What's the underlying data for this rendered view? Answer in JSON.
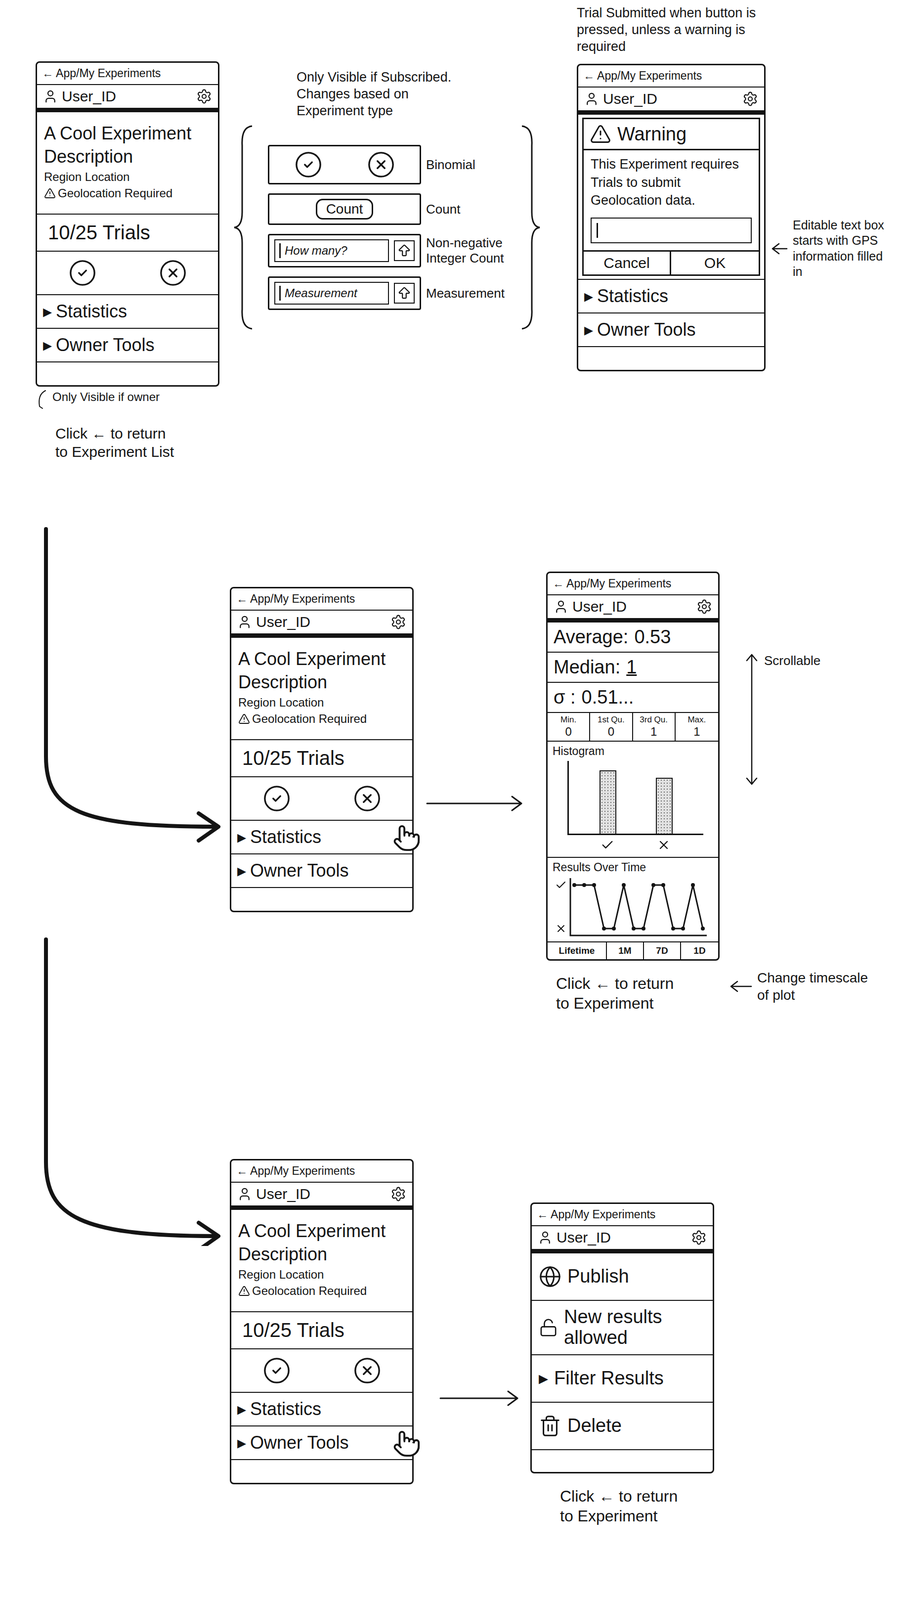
{
  "app_bar": {
    "back": "← App/My Experiments",
    "user": "User_ID"
  },
  "experiment": {
    "title": "A Cool Experiment",
    "description": "Description",
    "region": "Region Location",
    "geolocation": "Geolocation Required",
    "trials": "10/25 Trials",
    "sections": [
      {
        "marker": "▸",
        "label": "Statistics"
      },
      {
        "marker": "▸",
        "label": "Owner Tools"
      }
    ]
  },
  "experiment_screens": [
    {
      "pressed": [
        false,
        false
      ]
    },
    {
      "pressed": [
        true,
        false
      ]
    },
    {
      "pressed": [
        false,
        true
      ]
    }
  ],
  "experiment_notes": {
    "owner_only": "Only Visible if owner",
    "return": "Click ← to return to Experiment List"
  },
  "input_types": {
    "note": "Only Visible if Subscribed. Changes based on Experiment type",
    "items": [
      {
        "kind": "binomial",
        "label": "Binomial"
      },
      {
        "kind": "count",
        "label": "Count",
        "button": "Count"
      },
      {
        "kind": "integer",
        "label": "Non-negative Integer Count",
        "placeholder": "How many?"
      },
      {
        "kind": "measurement",
        "label": "Measurement",
        "placeholder": "Measurement"
      }
    ]
  },
  "warning": {
    "note": "Trial Submitted when button is pressed, unless a warning is required",
    "title": "Warning",
    "message": "This Experiment requires Trials to submit Geolocation data.",
    "field_note": "Editable text box starts with GPS information filled in",
    "buttons": [
      "Cancel",
      "OK"
    ]
  },
  "statistics": {
    "scroll_note": "Scrollable",
    "summary": [
      {
        "label": "Average:",
        "value": "0.53",
        "underlined": false
      },
      {
        "label": "Median:",
        "value": "1",
        "underlined": true
      },
      {
        "label": "σ :",
        "value": "0.51...",
        "underlined": false
      }
    ],
    "quartiles": [
      {
        "label": "Min.",
        "value": "0"
      },
      {
        "label": "1st Qu.",
        "value": "0"
      },
      {
        "label": "3rd Qu.",
        "value": "1"
      },
      {
        "label": "Max.",
        "value": "1"
      }
    ],
    "histogram": {
      "title": "Histogram",
      "values": [
        53,
        47
      ]
    },
    "timeline": {
      "title": "Results Over Time",
      "values": [
        1,
        1,
        1,
        0,
        0,
        1,
        0,
        0,
        1,
        1,
        0,
        0,
        1,
        0
      ]
    },
    "timescales": [
      "Lifetime",
      "1M",
      "7D",
      "1D"
    ],
    "timescale_note": "Change timescale of plot",
    "return": "Click ← to return to Experiment"
  },
  "owner_tools": {
    "items": [
      {
        "kind": "publish",
        "label": "Publish"
      },
      {
        "kind": "toggle",
        "label": "New results allowed"
      },
      {
        "kind": "expander",
        "marker": "▸",
        "label": "Filter Results"
      },
      {
        "kind": "delete",
        "label": "Delete"
      }
    ],
    "return": "Click ← to return to Experiment"
  }
}
